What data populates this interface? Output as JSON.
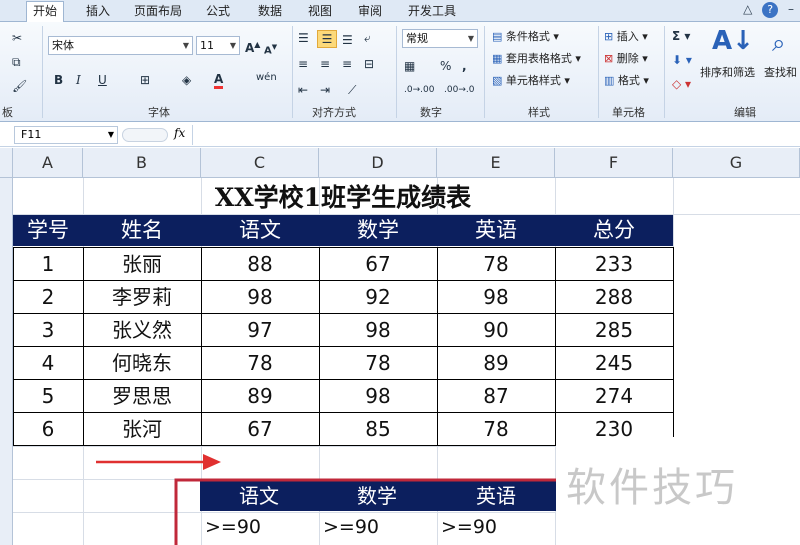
{
  "ribbon_tabs": [
    "开始",
    "插入",
    "页面布局",
    "公式",
    "数据",
    "视图",
    "审阅",
    "开发工具"
  ],
  "font": {
    "name": "宋体",
    "size": "11"
  },
  "number_format": "常规",
  "groups": {
    "clipboard": "板",
    "font": "字体",
    "alignment": "对齐方式",
    "number": "数字",
    "styles": "样式",
    "cells": "单元格",
    "editing": "编辑"
  },
  "styles_items": [
    "条件格式",
    "套用表格格式",
    "单元格样式"
  ],
  "cells_items": [
    "插入",
    "删除",
    "格式"
  ],
  "editing_items": [
    "排序和筛选",
    "查找和"
  ],
  "name_box": "F11",
  "fx": "fx",
  "columns": [
    "A",
    "B",
    "C",
    "D",
    "E",
    "F",
    "G"
  ],
  "sheet": {
    "title": "XX学校1班学生成绩表",
    "headers": [
      "学号",
      "姓名",
      "语文",
      "数学",
      "英语",
      "总分"
    ],
    "rows": [
      [
        "1",
        "张丽",
        "88",
        "67",
        "78",
        "233"
      ],
      [
        "2",
        "李罗莉",
        "98",
        "92",
        "98",
        "288"
      ],
      [
        "3",
        "张义然",
        "97",
        "98",
        "90",
        "285"
      ],
      [
        "4",
        "何晓东",
        "78",
        "78",
        "89",
        "245"
      ],
      [
        "5",
        "罗思思",
        "89",
        "98",
        "87",
        "274"
      ],
      [
        "6",
        "张河",
        "67",
        "85",
        "78",
        "230"
      ]
    ]
  },
  "criteria": {
    "headers": [
      "语文",
      "数学",
      "英语"
    ],
    "values": [
      ">=90",
      ">=90",
      ">=90"
    ]
  },
  "watermark": "软件技巧",
  "colors": {
    "header_bg": "#0c1f5e",
    "arrow": "#e03030"
  }
}
